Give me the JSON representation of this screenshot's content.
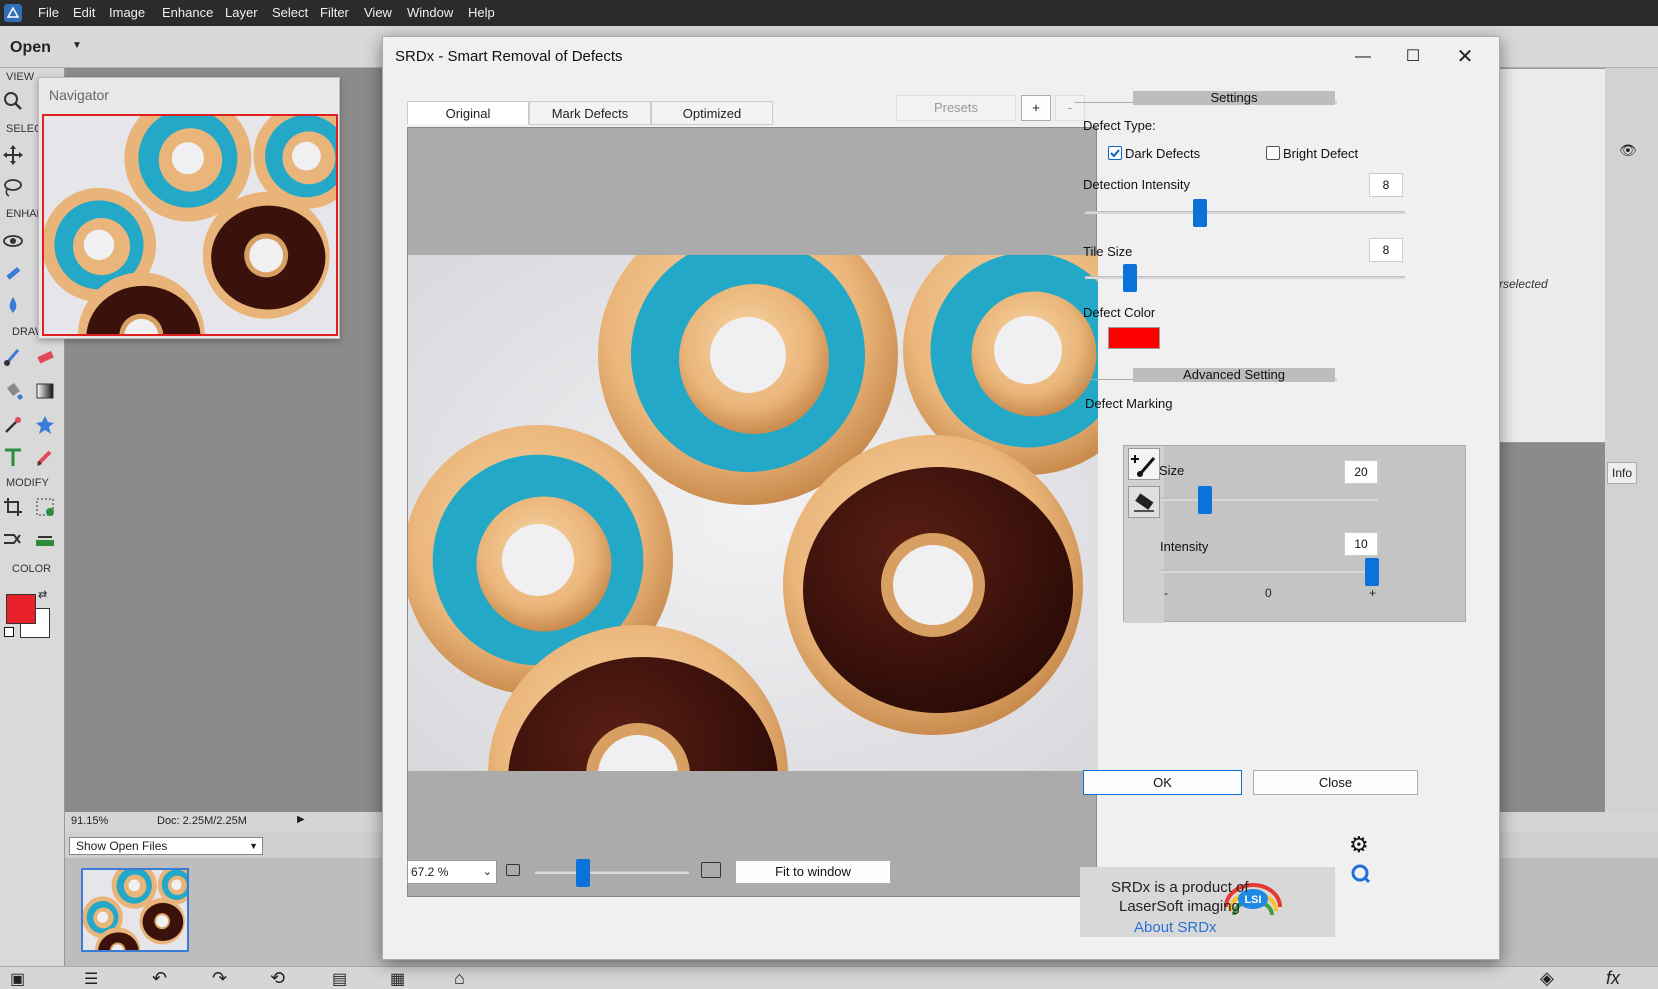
{
  "host": {
    "menu": [
      "File",
      "Edit",
      "Image",
      "Enhance",
      "Layer",
      "Select",
      "Filter",
      "View",
      "Window",
      "Help"
    ],
    "open_label": "Open",
    "toolbox": {
      "view": "VIEW",
      "select": "SELEC",
      "enhance": "ENHAN",
      "draw": "DRAW",
      "modify": "MODIFY",
      "color": "COLOR",
      "fg_color": "#e8202a"
    },
    "status": {
      "zoom": "91.15%",
      "doc": "Doc: 2.25M/2.25M"
    },
    "bin_dropdown": "Show Open Files",
    "info_tab": "Info",
    "behind_text": "rselected"
  },
  "navigator": {
    "title": "Navigator"
  },
  "dialog": {
    "title": "SRDx - Smart Removal of Defects",
    "tabs": [
      "Original",
      "Mark Defects",
      "Optimized"
    ],
    "presets_label": "Presets",
    "preset_add": "+",
    "preset_remove": "-",
    "zoom_value": "67.2 %",
    "fit_button": "Fit to window",
    "settings_section": "Settings",
    "defect_type_label": "Defect Type:",
    "dark_defects_label": "Dark Defects",
    "dark_defects_checked": true,
    "bright_defect_label": "Bright Defect",
    "bright_defect_checked": false,
    "detection_intensity_label": "Detection Intensity",
    "detection_intensity_value": "8",
    "tile_size_label": "Tile Size",
    "tile_size_value": "8",
    "defect_color_label": "Defect Color",
    "defect_color": "#ff0000",
    "advanced_section": "Advanced Setting",
    "defect_marking_label": "Defect Marking",
    "size_label": "Size",
    "size_value": "20",
    "intensity_label": "Intensity",
    "intensity_value": "10",
    "scale_min": "-",
    "scale_mid": "0",
    "scale_max": "+",
    "ok_button": "OK",
    "close_button": "Close",
    "promo_line1": "SRDx is a product of",
    "promo_line2": "LaserSoft imaging",
    "promo_link": "About SRDx",
    "promo_logo_text": "LSI",
    "accent": "#0a72d8"
  }
}
